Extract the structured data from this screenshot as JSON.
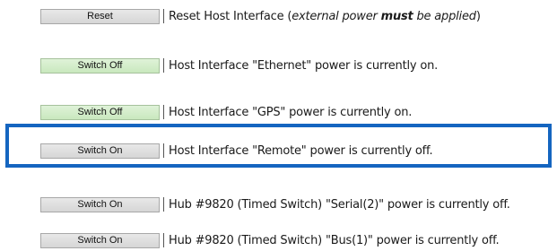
{
  "rows": [
    {
      "button": "Reset",
      "text_main": "Reset Host Interface (",
      "text_em1": "external power ",
      "text_strong": "must",
      "text_em2": " be applied",
      "text_end": ")"
    },
    {
      "button": "Switch Off",
      "text": "Host Interface \"Ethernet\" power is currently on."
    },
    {
      "button": "Switch Off",
      "text": "Host Interface \"GPS\" power is currently on."
    },
    {
      "button": "Switch On",
      "text": "Host Interface \"Remote\" power is currently off."
    },
    {
      "button": "Switch On",
      "text": "Hub #9820 (Timed Switch) \"Serial(2)\" power is currently off."
    },
    {
      "button": "Switch On",
      "text": "Hub #9820 (Timed Switch) \"Bus(1)\" power is currently off."
    }
  ],
  "colors": {
    "highlight_border": "#1565c0",
    "button_on_bg": "#dff2d8",
    "button_default_bg": "#e0e0e0"
  }
}
